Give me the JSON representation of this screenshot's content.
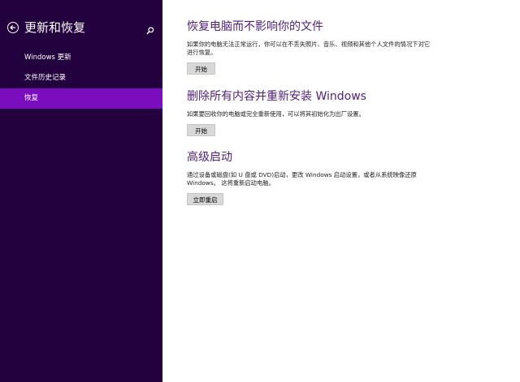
{
  "sidebar": {
    "title": "更新和恢复",
    "items": [
      {
        "label": "Windows 更新"
      },
      {
        "label": "文件历史记录"
      },
      {
        "label": "恢复"
      }
    ]
  },
  "main": {
    "sections": [
      {
        "title": "恢复电脑而不影响你的文件",
        "description": "如果你的电脑无法正常运行，你可以在不丢失照片、音乐、视频和其他个人文件的情况下对它进行恢复。",
        "button": "开始"
      },
      {
        "title": "删除所有内容并重新安装 Windows",
        "description": "如果要回收你的电脑或完全重新使用，可以将其初始化为出厂设置。",
        "button": "开始"
      },
      {
        "title": "高级启动",
        "description": "通过设备或磁盘(如 U 盘或 DVD)启动，更改 Windows 启动设置，或者从系统映像还原 Windows。 这将重新启动电脑。",
        "button": "立即重启"
      }
    ]
  },
  "colors": {
    "sidebar_bg": "#23003e",
    "selected_bg": "#7a0dbd",
    "heading": "#4f1f78"
  },
  "icons": [
    "back-arrow-icon",
    "search-icon"
  ]
}
